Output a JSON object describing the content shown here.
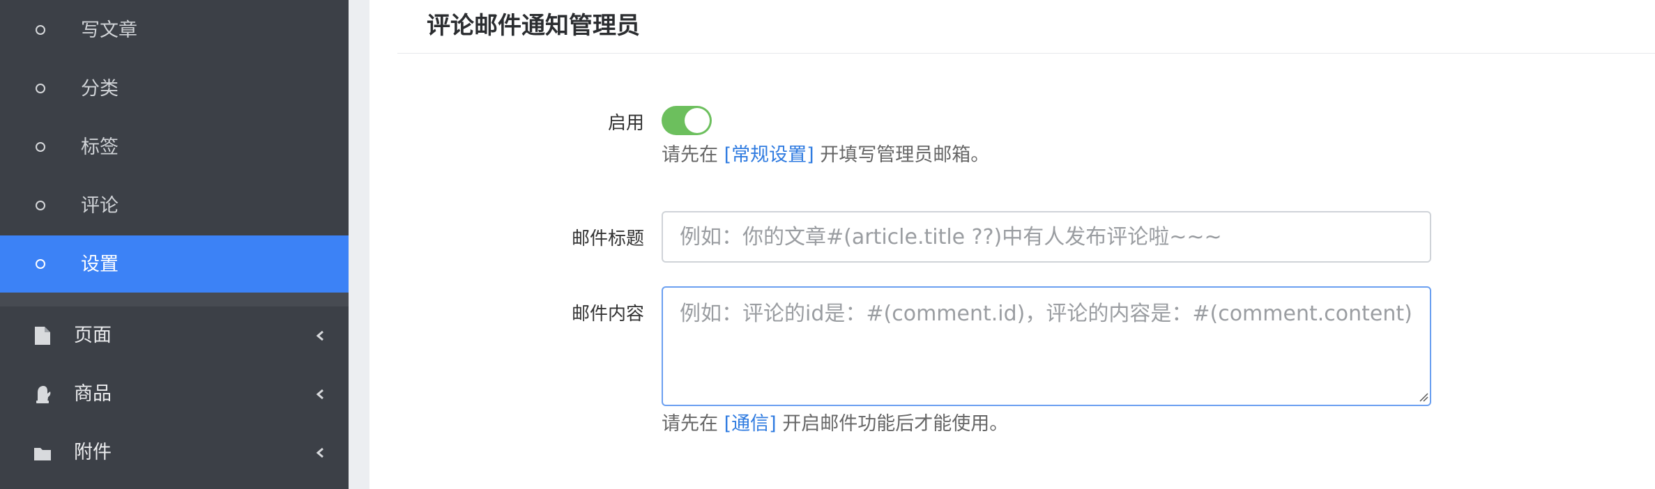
{
  "sidebar": {
    "sub_items": [
      {
        "label": "写文章",
        "icon": "circle-icon",
        "active": false
      },
      {
        "label": "分类",
        "icon": "circle-icon",
        "active": false
      },
      {
        "label": "标签",
        "icon": "circle-icon",
        "active": false
      },
      {
        "label": "评论",
        "icon": "circle-icon",
        "active": false
      },
      {
        "label": "设置",
        "icon": "circle-icon",
        "active": true
      }
    ],
    "menu_items": [
      {
        "label": "页面",
        "icon": "file-icon"
      },
      {
        "label": "商品",
        "icon": "mitten-icon"
      },
      {
        "label": "附件",
        "icon": "folder-icon"
      }
    ]
  },
  "card": {
    "title": "评论邮件通知管理员"
  },
  "form": {
    "enable_label": "启用",
    "enable_on": true,
    "enable_help_prefix": "请先在",
    "enable_help_link": "[常规设置]",
    "enable_help_suffix": "开填写管理员邮箱。",
    "subject_label": "邮件标题",
    "subject_value": "",
    "subject_placeholder": "例如：你的文章#(article.title ??)中有人发布评论啦~~~",
    "content_label": "邮件内容",
    "content_value": "",
    "content_placeholder": "例如：评论的id是：#(comment.id)，评论的内容是：#(comment.content)",
    "content_help_prefix": "请先在",
    "content_help_link": "[通信]",
    "content_help_suffix": "开启邮件功能后才能使用。"
  },
  "colors": {
    "sidebar_bg": "#3c4047",
    "active_bg": "#3c82f6",
    "toggle_on": "#6cbf5d",
    "link": "#2f7be0"
  }
}
